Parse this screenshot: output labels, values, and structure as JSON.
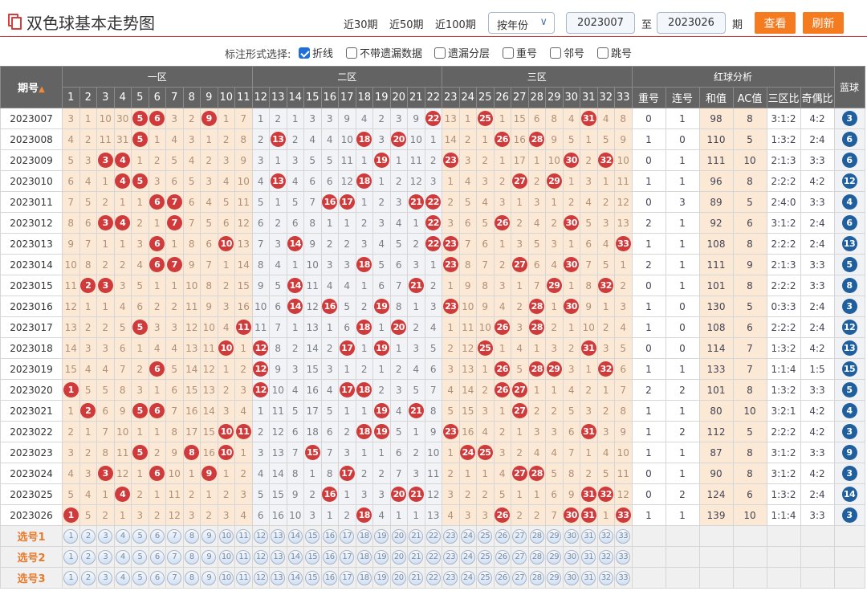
{
  "header": {
    "title": "双色球基本走势图",
    "quick_ranges": [
      "近30期",
      "近50期",
      "近100期"
    ],
    "mode_select": "按年份",
    "from_issue": "2023007",
    "to_label": "至",
    "to_issue": "2023026",
    "issue_suffix": "期",
    "view_button": "查看",
    "refresh_button": "刷新"
  },
  "options": {
    "label": "标注形式选择:",
    "items": [
      {
        "label": "折线",
        "checked": true
      },
      {
        "label": "不带遗漏数据",
        "checked": false
      },
      {
        "label": "遗漏分层",
        "checked": false
      },
      {
        "label": "重号",
        "checked": false
      },
      {
        "label": "邻号",
        "checked": false
      },
      {
        "label": "跳号",
        "checked": false
      }
    ]
  },
  "table": {
    "issue_header": "期号",
    "zone_headers": [
      "一区",
      "二区",
      "三区"
    ],
    "analysis_header": "红球分析",
    "blue_header": "蓝球",
    "analysis_columns": [
      "重号",
      "连号",
      "和值",
      "AC值",
      "三区比",
      "奇偶比"
    ],
    "number_columns": [
      "1",
      "2",
      "3",
      "4",
      "5",
      "6",
      "7",
      "8",
      "9",
      "10",
      "11",
      "12",
      "13",
      "14",
      "15",
      "16",
      "17",
      "18",
      "19",
      "20",
      "21",
      "22",
      "23",
      "24",
      "25",
      "26",
      "27",
      "28",
      "29",
      "30",
      "31",
      "32",
      "33"
    ],
    "rows": [
      {
        "issue": "2023007",
        "cells": [
          3,
          1,
          10,
          30,
          5,
          6,
          3,
          2,
          9,
          1,
          7,
          1,
          2,
          1,
          3,
          3,
          9,
          4,
          2,
          3,
          9,
          22,
          13,
          1,
          25,
          1,
          15,
          6,
          8,
          4,
          31,
          4,
          8
        ],
        "hits": [
          5,
          6,
          9,
          22,
          25,
          31
        ],
        "repeat": "0",
        "consec": "1",
        "sum": "98",
        "ac": "8",
        "zone_ratio": "3:1:2",
        "odd_even": "4:2",
        "blue": "3"
      },
      {
        "issue": "2023008",
        "cells": [
          4,
          2,
          11,
          31,
          5,
          1,
          4,
          3,
          1,
          2,
          8,
          2,
          13,
          2,
          4,
          4,
          10,
          18,
          3,
          20,
          10,
          1,
          14,
          2,
          1,
          26,
          16,
          28,
          9,
          5,
          1,
          5,
          9
        ],
        "hits": [
          5,
          13,
          18,
          20,
          26,
          28
        ],
        "repeat": "1",
        "consec": "0",
        "sum": "110",
        "ac": "5",
        "zone_ratio": "1:3:2",
        "odd_even": "2:4",
        "blue": "6"
      },
      {
        "issue": "2023009",
        "cells": [
          5,
          3,
          3,
          4,
          1,
          2,
          5,
          4,
          2,
          3,
          9,
          3,
          1,
          3,
          5,
          5,
          11,
          1,
          19,
          1,
          11,
          2,
          23,
          3,
          2,
          1,
          17,
          1,
          10,
          30,
          2,
          32,
          10
        ],
        "hits": [
          3,
          4,
          19,
          23,
          30,
          32
        ],
        "repeat": "0",
        "consec": "1",
        "sum": "111",
        "ac": "10",
        "zone_ratio": "2:1:3",
        "odd_even": "3:3",
        "blue": "6"
      },
      {
        "issue": "2023010",
        "cells": [
          6,
          4,
          1,
          4,
          5,
          3,
          6,
          5,
          3,
          4,
          10,
          4,
          13,
          4,
          6,
          6,
          12,
          18,
          1,
          2,
          12,
          3,
          1,
          4,
          3,
          2,
          27,
          2,
          29,
          1,
          3,
          1,
          11
        ],
        "hits": [
          4,
          5,
          13,
          18,
          27,
          29
        ],
        "repeat": "1",
        "consec": "1",
        "sum": "96",
        "ac": "8",
        "zone_ratio": "2:2:2",
        "odd_even": "4:2",
        "blue": "12"
      },
      {
        "issue": "2023011",
        "cells": [
          7,
          5,
          2,
          1,
          1,
          6,
          7,
          6,
          4,
          5,
          11,
          5,
          1,
          5,
          7,
          16,
          17,
          1,
          2,
          3,
          21,
          22,
          2,
          5,
          4,
          3,
          1,
          3,
          1,
          2,
          4,
          2,
          12
        ],
        "hits": [
          6,
          7,
          16,
          17,
          21,
          22
        ],
        "repeat": "0",
        "consec": "3",
        "sum": "89",
        "ac": "5",
        "zone_ratio": "2:4:0",
        "odd_even": "3:3",
        "blue": "4"
      },
      {
        "issue": "2023012",
        "cells": [
          8,
          6,
          3,
          4,
          2,
          1,
          7,
          7,
          5,
          6,
          12,
          6,
          2,
          6,
          8,
          1,
          1,
          2,
          3,
          4,
          1,
          22,
          3,
          6,
          5,
          26,
          2,
          4,
          2,
          30,
          5,
          3,
          13
        ],
        "hits": [
          3,
          4,
          7,
          22,
          26,
          30
        ],
        "repeat": "2",
        "consec": "1",
        "sum": "92",
        "ac": "6",
        "zone_ratio": "3:1:2",
        "odd_even": "2:4",
        "blue": "6"
      },
      {
        "issue": "2023013",
        "cells": [
          9,
          7,
          1,
          1,
          3,
          6,
          1,
          8,
          6,
          10,
          13,
          7,
          3,
          14,
          9,
          2,
          2,
          3,
          4,
          5,
          2,
          22,
          23,
          7,
          6,
          1,
          3,
          5,
          3,
          1,
          6,
          4,
          33
        ],
        "hits": [
          6,
          10,
          14,
          22,
          23,
          33
        ],
        "repeat": "1",
        "consec": "1",
        "sum": "108",
        "ac": "8",
        "zone_ratio": "2:2:2",
        "odd_even": "2:4",
        "blue": "13"
      },
      {
        "issue": "2023014",
        "cells": [
          10,
          8,
          2,
          2,
          4,
          6,
          7,
          9,
          7,
          1,
          14,
          8,
          4,
          1,
          10,
          3,
          3,
          18,
          5,
          6,
          3,
          1,
          23,
          8,
          7,
          2,
          27,
          6,
          4,
          30,
          7,
          5,
          1
        ],
        "hits": [
          6,
          7,
          18,
          23,
          27,
          30
        ],
        "repeat": "2",
        "consec": "1",
        "sum": "111",
        "ac": "9",
        "zone_ratio": "2:1:3",
        "odd_even": "3:3",
        "blue": "5"
      },
      {
        "issue": "2023015",
        "cells": [
          11,
          2,
          3,
          3,
          5,
          1,
          1,
          10,
          8,
          2,
          15,
          9,
          5,
          14,
          11,
          4,
          4,
          1,
          6,
          7,
          21,
          2,
          1,
          9,
          8,
          3,
          1,
          7,
          29,
          1,
          8,
          32,
          2
        ],
        "hits": [
          2,
          3,
          14,
          21,
          29,
          32
        ],
        "repeat": "0",
        "consec": "1",
        "sum": "101",
        "ac": "8",
        "zone_ratio": "2:2:2",
        "odd_even": "3:3",
        "blue": "8"
      },
      {
        "issue": "2023016",
        "cells": [
          12,
          1,
          1,
          4,
          6,
          2,
          2,
          11,
          9,
          3,
          16,
          10,
          6,
          14,
          12,
          16,
          5,
          2,
          19,
          8,
          1,
          3,
          23,
          10,
          9,
          4,
          2,
          28,
          1,
          30,
          9,
          1,
          3
        ],
        "hits": [
          14,
          16,
          19,
          23,
          28,
          30
        ],
        "repeat": "1",
        "consec": "0",
        "sum": "130",
        "ac": "5",
        "zone_ratio": "0:3:3",
        "odd_even": "2:4",
        "blue": "3"
      },
      {
        "issue": "2023017",
        "cells": [
          13,
          2,
          2,
          5,
          5,
          3,
          3,
          12,
          10,
          4,
          11,
          11,
          7,
          1,
          13,
          1,
          6,
          18,
          1,
          20,
          2,
          4,
          1,
          11,
          10,
          26,
          3,
          28,
          2,
          1,
          10,
          2,
          4
        ],
        "hits": [
          5,
          11,
          18,
          20,
          26,
          28
        ],
        "repeat": "1",
        "consec": "0",
        "sum": "108",
        "ac": "6",
        "zone_ratio": "2:2:2",
        "odd_even": "2:4",
        "blue": "12"
      },
      {
        "issue": "2023018",
        "cells": [
          14,
          3,
          3,
          6,
          1,
          4,
          4,
          13,
          11,
          10,
          1,
          12,
          8,
          2,
          14,
          2,
          17,
          1,
          19,
          1,
          3,
          5,
          2,
          12,
          25,
          1,
          4,
          1,
          3,
          2,
          31,
          3,
          5
        ],
        "hits": [
          10,
          12,
          17,
          19,
          25,
          31
        ],
        "repeat": "0",
        "consec": "0",
        "sum": "114",
        "ac": "7",
        "zone_ratio": "1:3:2",
        "odd_even": "4:2",
        "blue": "13"
      },
      {
        "issue": "2023019",
        "cells": [
          15,
          4,
          4,
          7,
          2,
          6,
          5,
          14,
          12,
          1,
          2,
          12,
          9,
          3,
          15,
          3,
          1,
          2,
          1,
          2,
          4,
          6,
          3,
          13,
          1,
          26,
          5,
          28,
          29,
          3,
          1,
          32,
          6
        ],
        "hits": [
          6,
          12,
          26,
          28,
          29,
          32
        ],
        "repeat": "1",
        "consec": "1",
        "sum": "133",
        "ac": "7",
        "zone_ratio": "1:1:4",
        "odd_even": "1:5",
        "blue": "15"
      },
      {
        "issue": "2023020",
        "cells": [
          1,
          5,
          5,
          8,
          3,
          1,
          6,
          15,
          13,
          2,
          3,
          12,
          10,
          4,
          16,
          4,
          17,
          18,
          2,
          3,
          5,
          7,
          4,
          14,
          2,
          26,
          27,
          1,
          1,
          4,
          2,
          1,
          7
        ],
        "hits": [
          1,
          12,
          17,
          18,
          26,
          27
        ],
        "repeat": "2",
        "consec": "2",
        "sum": "101",
        "ac": "8",
        "zone_ratio": "1:3:2",
        "odd_even": "3:3",
        "blue": "5"
      },
      {
        "issue": "2023021",
        "cells": [
          1,
          2,
          6,
          9,
          5,
          6,
          7,
          16,
          14,
          3,
          4,
          1,
          11,
          5,
          17,
          5,
          1,
          1,
          19,
          4,
          21,
          8,
          5,
          15,
          3,
          1,
          27,
          2,
          2,
          5,
          3,
          2,
          8
        ],
        "hits": [
          2,
          5,
          6,
          19,
          21,
          27
        ],
        "repeat": "1",
        "consec": "1",
        "sum": "80",
        "ac": "10",
        "zone_ratio": "3:2:1",
        "odd_even": "4:2",
        "blue": "4"
      },
      {
        "issue": "2023022",
        "cells": [
          2,
          1,
          7,
          10,
          1,
          1,
          8,
          17,
          15,
          10,
          11,
          2,
          12,
          6,
          18,
          6,
          2,
          18,
          19,
          5,
          1,
          9,
          23,
          16,
          4,
          2,
          1,
          3,
          3,
          6,
          31,
          3,
          9
        ],
        "hits": [
          10,
          11,
          18,
          19,
          23,
          31
        ],
        "repeat": "1",
        "consec": "2",
        "sum": "112",
        "ac": "5",
        "zone_ratio": "2:2:2",
        "odd_even": "4:2",
        "blue": "3"
      },
      {
        "issue": "2023023",
        "cells": [
          3,
          2,
          8,
          11,
          5,
          2,
          9,
          8,
          16,
          10,
          1,
          3,
          13,
          7,
          15,
          7,
          3,
          1,
          1,
          6,
          2,
          10,
          1,
          24,
          25,
          3,
          2,
          4,
          4,
          7,
          1,
          4,
          10
        ],
        "hits": [
          5,
          8,
          10,
          15,
          24,
          25
        ],
        "repeat": "1",
        "consec": "1",
        "sum": "87",
        "ac": "8",
        "zone_ratio": "3:1:2",
        "odd_even": "3:3",
        "blue": "9"
      },
      {
        "issue": "2023024",
        "cells": [
          4,
          3,
          3,
          12,
          1,
          6,
          10,
          1,
          9,
          1,
          2,
          4,
          14,
          8,
          1,
          8,
          17,
          2,
          2,
          7,
          3,
          11,
          2,
          1,
          1,
          4,
          27,
          28,
          5,
          8,
          2,
          5,
          11
        ],
        "hits": [
          3,
          6,
          9,
          17,
          27,
          28
        ],
        "repeat": "0",
        "consec": "1",
        "sum": "90",
        "ac": "8",
        "zone_ratio": "3:1:2",
        "odd_even": "4:2",
        "blue": "3"
      },
      {
        "issue": "2023025",
        "cells": [
          5,
          4,
          1,
          4,
          2,
          1,
          11,
          2,
          1,
          2,
          3,
          5,
          15,
          9,
          2,
          16,
          1,
          3,
          3,
          20,
          21,
          12,
          3,
          2,
          2,
          5,
          1,
          1,
          6,
          9,
          31,
          32,
          12
        ],
        "hits": [
          4,
          16,
          20,
          21,
          31,
          32
        ],
        "repeat": "0",
        "consec": "2",
        "sum": "124",
        "ac": "6",
        "zone_ratio": "1:3:2",
        "odd_even": "2:4",
        "blue": "14"
      },
      {
        "issue": "2023026",
        "cells": [
          1,
          5,
          2,
          1,
          3,
          2,
          12,
          3,
          2,
          3,
          4,
          6,
          16,
          10,
          3,
          1,
          2,
          18,
          4,
          1,
          1,
          13,
          4,
          3,
          3,
          26,
          2,
          2,
          7,
          30,
          31,
          1,
          33
        ],
        "hits": [
          1,
          18,
          26,
          30,
          31,
          33
        ],
        "repeat": "1",
        "consec": "1",
        "sum": "139",
        "ac": "10",
        "zone_ratio": "1:1:4",
        "odd_even": "3:3",
        "blue": "3"
      }
    ],
    "pick_rows": [
      "选号1",
      "选号2",
      "选号3"
    ]
  },
  "colors": {
    "red_ball": "#d03a3a",
    "blue_ball": "#1f5f9e",
    "button": "#f47b20",
    "zone_warm": "#fbe9d6",
    "zone_cool": "#f1f3f6",
    "header_bg": "#636363"
  }
}
